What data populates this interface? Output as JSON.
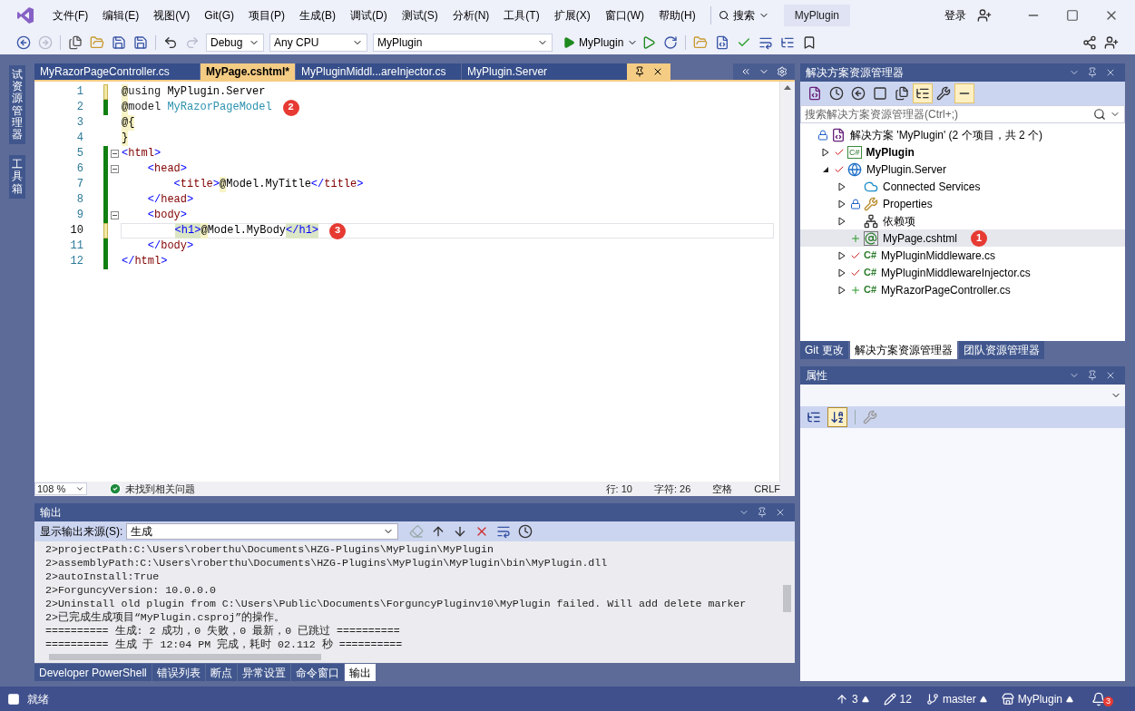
{
  "title_bar": {
    "menu": [
      "文件(F)",
      "编辑(E)",
      "视图(V)",
      "Git(G)",
      "项目(P)",
      "生成(B)",
      "调试(D)",
      "测试(S)",
      "分析(N)",
      "工具(T)",
      "扩展(X)",
      "窗口(W)",
      "帮助(H)"
    ],
    "search": "搜索",
    "solution_name": "MyPlugin",
    "sign_in": "登录"
  },
  "toolbar": {
    "configuration": "Debug",
    "platform": "Any CPU",
    "startup_project": "MyPlugin",
    "run": "MyPlugin"
  },
  "side_strip": [
    "试资源管理器",
    "工具箱"
  ],
  "editor": {
    "tabs": [
      {
        "label": "MyRazorPageController.cs",
        "selected": false
      },
      {
        "label": "MyPage.cshtml*",
        "selected": true
      },
      {
        "label": "MyPluginMiddl...areInjector.cs",
        "selected": false
      },
      {
        "label": "MyPlugin.Server",
        "selected": false
      }
    ],
    "lines": [
      {
        "number": "1",
        "saved": false,
        "modified": true,
        "fold": false,
        "current": false,
        "tokens": [
          {
            "kind": "at",
            "text": "@"
          },
          {
            "kind": "kw",
            "text": "using"
          },
          {
            "kind": "text",
            "text": " MyPlugin.Server"
          }
        ]
      },
      {
        "number": "2",
        "saved": true,
        "modified": false,
        "fold": false,
        "current": false,
        "badge": "2",
        "tokens": [
          {
            "kind": "at",
            "text": "@"
          },
          {
            "kind": "kw",
            "text": "model "
          },
          {
            "kind": "type",
            "text": "MyRazorPageModel"
          }
        ]
      },
      {
        "number": "3",
        "saved": false,
        "modified": false,
        "fold": false,
        "current": false,
        "tokens": [
          {
            "kind": "at",
            "text": "@{"
          }
        ]
      },
      {
        "number": "4",
        "saved": false,
        "modified": false,
        "fold": false,
        "current": false,
        "tokens": [
          {
            "kind": "at",
            "text": "}"
          }
        ]
      },
      {
        "number": "5",
        "saved": true,
        "modified": false,
        "fold": true,
        "current": false,
        "tokens": [
          {
            "kind": "bracket",
            "text": "<"
          },
          {
            "kind": "tag",
            "text": "html"
          },
          {
            "kind": "bracket",
            "text": ">"
          }
        ]
      },
      {
        "number": "6",
        "saved": true,
        "modified": false,
        "fold": true,
        "current": false,
        "tokens": [
          {
            "kind": "bracket",
            "text": "    <"
          },
          {
            "kind": "tag",
            "text": "head"
          },
          {
            "kind": "bracket",
            "text": ">"
          }
        ]
      },
      {
        "number": "7",
        "saved": true,
        "modified": false,
        "fold": false,
        "current": false,
        "tokens": [
          {
            "kind": "bracket",
            "text": "        <"
          },
          {
            "kind": "tag",
            "text": "title"
          },
          {
            "kind": "bracket",
            "text": ">"
          },
          {
            "kind": "at",
            "text": "@"
          },
          {
            "kind": "text",
            "text": "Model.MyTitle"
          },
          {
            "kind": "bracket",
            "text": "</"
          },
          {
            "kind": "tag",
            "text": "title"
          },
          {
            "kind": "bracket",
            "text": ">"
          }
        ]
      },
      {
        "number": "8",
        "saved": true,
        "modified": false,
        "fold": false,
        "current": false,
        "tokens": [
          {
            "kind": "bracket",
            "text": "    </"
          },
          {
            "kind": "tag",
            "text": "head"
          },
          {
            "kind": "bracket",
            "text": ">"
          }
        ]
      },
      {
        "number": "9",
        "saved": true,
        "modified": false,
        "fold": true,
        "current": false,
        "tokens": [
          {
            "kind": "bracket",
            "text": "    <"
          },
          {
            "kind": "tag",
            "text": "body"
          },
          {
            "kind": "bracket",
            "text": ">"
          }
        ]
      },
      {
        "number": "10",
        "saved": false,
        "modified": true,
        "fold": false,
        "current": true,
        "badge": "3",
        "tokens": [
          {
            "kind": "match",
            "text": "        <h1>"
          },
          {
            "kind": "at",
            "text": "@"
          },
          {
            "kind": "text",
            "text": "Model.MyBody"
          },
          {
            "kind": "match",
            "text": "</h1>"
          }
        ]
      },
      {
        "number": "11",
        "saved": true,
        "modified": false,
        "fold": false,
        "current": false,
        "tokens": [
          {
            "kind": "bracket",
            "text": "    </"
          },
          {
            "kind": "tag",
            "text": "body"
          },
          {
            "kind": "bracket",
            "text": ">"
          }
        ]
      },
      {
        "number": "12",
        "saved": true,
        "modified": false,
        "fold": false,
        "current": false,
        "tokens": [
          {
            "kind": "bracket",
            "text": "</"
          },
          {
            "kind": "tag",
            "text": "html"
          },
          {
            "kind": "bracket",
            "text": ">"
          }
        ]
      }
    ],
    "status": {
      "zoom": "108 %",
      "issues": "未找到相关问题",
      "line": "行: 10",
      "char": "字符: 26",
      "spacing": "空格",
      "eol": "CRLF"
    }
  },
  "output": {
    "title": "输出",
    "source_label": "显示输出来源(S):",
    "source": "生成",
    "lines": [
      "2>projectPath:C:\\Users\\roberthu\\Documents\\HZG-Plugins\\MyPlugin\\MyPlugin",
      "2>assemblyPath:C:\\Users\\roberthu\\Documents\\HZG-Plugins\\MyPlugin\\MyPlugin\\bin\\MyPlugin.dll",
      "2>autoInstall:True",
      "2>ForguncyVersion: 10.0.0.0",
      "2>Uninstall old plugin from C:\\Users\\Public\\Documents\\ForguncyPluginv10\\MyPlugin failed. Will add delete marker",
      "2>已完成生成项目“MyPlugin.csproj”的操作。",
      "========== 生成: 2 成功，0 失败，0 最新，0 已跳过 ==========",
      "========== 生成 于 12:04 PM 完成，耗时 02.112 秒 =========="
    ]
  },
  "bottom_tabs": [
    {
      "label": "Developer PowerShell",
      "selected": false
    },
    {
      "label": "错误列表",
      "selected": false
    },
    {
      "label": "断点",
      "selected": false
    },
    {
      "label": "异常设置",
      "selected": false
    },
    {
      "label": "命令窗口",
      "selected": false
    },
    {
      "label": "输出",
      "selected": true
    }
  ],
  "solution_explorer": {
    "title": "解决方案资源管理器",
    "search": {
      "placeholder": "搜索解决方案资源管理器(Ctrl+;)"
    },
    "tree": [
      {
        "label": "解决方案 'MyPlugin' (2 个项目，共 2 个)",
        "kind": "solution",
        "locked": true,
        "checked": false,
        "added": false,
        "selected": false,
        "bold": false,
        "children": [
          {
            "label": "MyPlugin",
            "kind": "csharp-project",
            "icon_text": "C#",
            "locked": false,
            "checked": true,
            "added": false,
            "expanded": false,
            "selected": false,
            "bold": true
          },
          {
            "label": "MyPlugin.Server",
            "kind": "web-project",
            "locked": false,
            "checked": true,
            "added": false,
            "expanded": true,
            "selected": false,
            "bold": false,
            "children": [
              {
                "label": "Connected Services",
                "kind": "connected",
                "locked": false,
                "checked": false,
                "added": false,
                "expanded": false,
                "selected": false,
                "bold": false
              },
              {
                "label": "Properties",
                "kind": "properties",
                "locked": true,
                "checked": false,
                "added": false,
                "expanded": false,
                "selected": false,
                "bold": false
              },
              {
                "label": "依赖项",
                "kind": "dependencies",
                "locked": false,
                "checked": false,
                "added": false,
                "expanded": false,
                "selected": false,
                "bold": false
              },
              {
                "label": "MyPage.cshtml",
                "kind": "razor",
                "locked": false,
                "checked": false,
                "added": true,
                "selected": true,
                "bold": false,
                "badge": "1"
              },
              {
                "label": "MyPluginMiddleware.cs",
                "kind": "csharp",
                "icon_text": "C#",
                "locked": false,
                "checked": true,
                "added": false,
                "expanded": false,
                "selected": false,
                "bold": false
              },
              {
                "label": "MyPluginMiddlewareInjector.cs",
                "kind": "csharp",
                "icon_text": "C#",
                "locked": false,
                "checked": true,
                "added": false,
                "expanded": false,
                "selected": false,
                "bold": false
              },
              {
                "label": "MyRazorPageController.cs",
                "kind": "csharp",
                "icon_text": "C#",
                "locked": false,
                "checked": false,
                "added": true,
                "expanded": false,
                "selected": false,
                "bold": false
              }
            ]
          }
        ]
      }
    ],
    "tabs": [
      {
        "label": "Git 更改",
        "selected": false
      },
      {
        "label": "解决方案资源管理器",
        "selected": true
      },
      {
        "label": "团队资源管理器",
        "selected": false
      }
    ]
  },
  "properties": {
    "title": "属性",
    "sort_buttons": [
      {
        "kind": "categorized",
        "selected": false
      },
      {
        "kind": "alphabetical",
        "selected": true
      }
    ]
  },
  "status_bar": {
    "message": "就绪",
    "pending": "3",
    "edits": "12",
    "branch": "master",
    "repo": "MyPlugin",
    "notifications": "3"
  }
}
